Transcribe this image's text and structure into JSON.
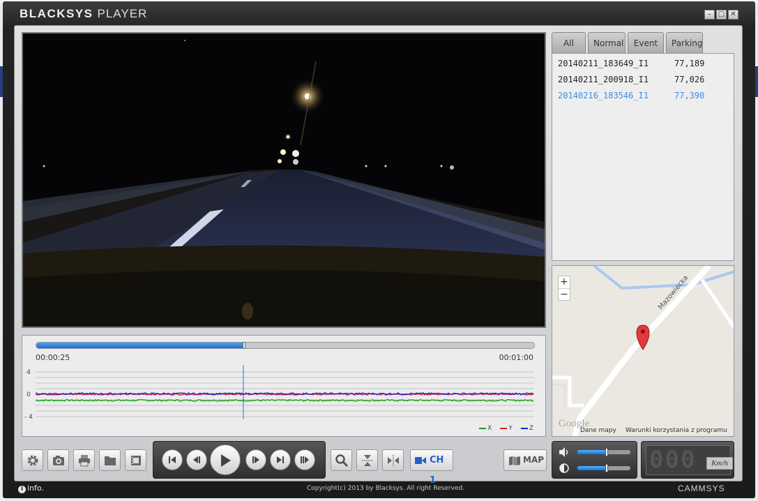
{
  "app": {
    "brand_bold": "BLACKSYS",
    "brand_light": "PLAYER",
    "window_buttons": {
      "minimize": "–",
      "maximize": "□",
      "close": "✕"
    }
  },
  "file_tabs": [
    {
      "label": "All",
      "active": true
    },
    {
      "label": "Normal",
      "active": false
    },
    {
      "label": "Event",
      "active": false
    },
    {
      "label": "Parking",
      "active": false
    }
  ],
  "files": [
    {
      "name": "20140211_183649_I1",
      "size": "77,189",
      "selected": false
    },
    {
      "name": "20140211_200918_I1",
      "size": "77,026",
      "selected": false
    },
    {
      "name": "20140216_183546_I1",
      "size": "77,390",
      "selected": true
    }
  ],
  "map": {
    "zoom_in": "+",
    "zoom_out": "−",
    "street": "Mazowiecka",
    "logo": "Google",
    "data_label": "Dane mapy",
    "terms_label": "Warunki korzystania z programu",
    "pin_icon": "map-pin-icon"
  },
  "timeline": {
    "current": "00:00:25",
    "total": "00:01:00",
    "progress": 0.4167
  },
  "chart_data": {
    "type": "line",
    "y_ticks": [
      "4",
      "0",
      "- 4"
    ],
    "ylim": [
      -4,
      4
    ],
    "series": [
      {
        "name": "X",
        "color": "#10a010",
        "level": -1.1
      },
      {
        "name": "Y",
        "color": "#e02020",
        "level": 0.0
      },
      {
        "name": "Z",
        "color": "#1020e0",
        "level": 0.1
      }
    ],
    "cursor_fraction": 0.4167
  },
  "controls": {
    "settings_icon": "gear-icon",
    "snapshot_icon": "camera-icon",
    "print_icon": "printer-icon",
    "folder_icon": "folder-icon",
    "export_icon": "film-icon",
    "zoom_icon": "magnifier-icon",
    "flip_v_icon": "flip-vertical-icon",
    "flip_h_icon": "flip-horizontal-icon",
    "channel_label": "CH 1",
    "map_label": "MAP"
  },
  "audio": {
    "volume": 0.55,
    "brightness": 0.55
  },
  "speed": {
    "digits": "000",
    "unit": "Km/h"
  },
  "footer": {
    "info": "info.",
    "copyright": "Copyright(c) 2013 by Blacksys. All right Reserved.",
    "vendor": "CAMMSYS"
  }
}
